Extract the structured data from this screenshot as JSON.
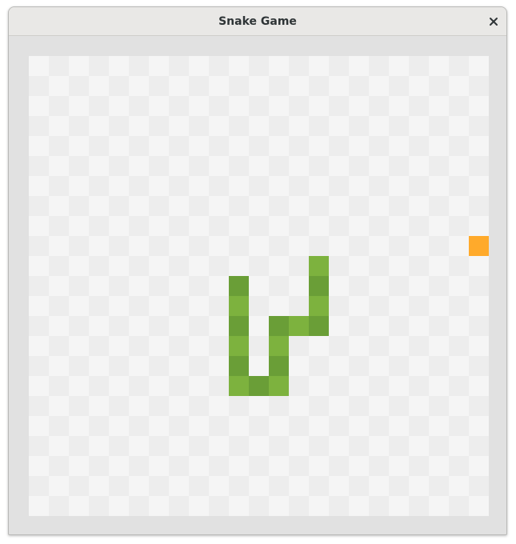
{
  "window": {
    "title": "Snake Game",
    "close_icon": "close-icon"
  },
  "game": {
    "grid": {
      "cols": 23,
      "rows": 23
    },
    "colors": {
      "background": "#e1e1e1",
      "cell_light": "#f5f5f5",
      "cell_dark": "#ededed",
      "snake_light": "#7db23e",
      "snake_dark": "#6a9e37",
      "food": "#ffaa2b"
    },
    "food": [
      {
        "col": 22,
        "row": 9
      }
    ],
    "snake": [
      {
        "col": 14,
        "row": 10
      },
      {
        "col": 14,
        "row": 11
      },
      {
        "col": 14,
        "row": 12
      },
      {
        "col": 14,
        "row": 13
      },
      {
        "col": 13,
        "row": 13
      },
      {
        "col": 12,
        "row": 13
      },
      {
        "col": 12,
        "row": 14
      },
      {
        "col": 12,
        "row": 15
      },
      {
        "col": 12,
        "row": 16
      },
      {
        "col": 11,
        "row": 16
      },
      {
        "col": 10,
        "row": 16
      },
      {
        "col": 10,
        "row": 15
      },
      {
        "col": 10,
        "row": 14
      },
      {
        "col": 10,
        "row": 13
      },
      {
        "col": 10,
        "row": 12
      },
      {
        "col": 10,
        "row": 11
      }
    ]
  }
}
